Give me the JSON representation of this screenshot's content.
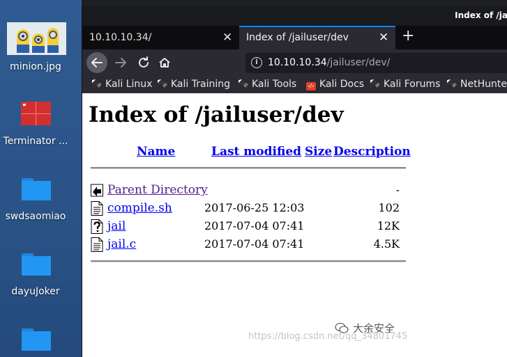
{
  "desktop": {
    "icons": [
      {
        "label": "minion.jpg",
        "icon": "image-thumbnail-icon"
      },
      {
        "label": "Terminator ...",
        "icon": "terminator-icon"
      },
      {
        "label": "swdsaomiao",
        "icon": "folder-icon"
      },
      {
        "label": "dayuJoker",
        "icon": "folder-icon"
      },
      {
        "label": "",
        "icon": "folder-icon"
      }
    ]
  },
  "browser": {
    "window_title": "Index of /ja",
    "tabs": [
      {
        "label": "10.10.10.34/",
        "active": false
      },
      {
        "label": "Index of /jailuser/dev",
        "active": true
      }
    ],
    "new_tab_symbol": "+",
    "close_symbol": "✕",
    "url_host": "10.10.10.34",
    "url_path": "/jailuser/dev/",
    "bookmarks": [
      "Kali Linux",
      "Kali Training",
      "Kali Tools",
      "Kali Docs",
      "Kali Forums",
      "NetHunter"
    ]
  },
  "page": {
    "heading": "Index of /jailuser/dev",
    "columns": {
      "name": "Name",
      "last_modified": "Last modified",
      "size": "Size",
      "description": "Description"
    },
    "entries": [
      {
        "name": "Parent Directory",
        "date": "",
        "size": "-",
        "icon": "back-folder-icon",
        "visited": true
      },
      {
        "name": "compile.sh",
        "date": "2017-06-25 12:03",
        "size": "102",
        "icon": "text-file-icon",
        "visited": false
      },
      {
        "name": "jail",
        "date": "2017-07-04 07:41",
        "size": "12K",
        "icon": "unknown-file-icon",
        "visited": false
      },
      {
        "name": "jail.c",
        "date": "2017-07-04 07:41",
        "size": "4.5K",
        "icon": "text-file-icon",
        "visited": false
      }
    ]
  },
  "overlay": {
    "watermark": "https://blog.csdn.net/qq_34801745",
    "brand": "大余安全"
  }
}
